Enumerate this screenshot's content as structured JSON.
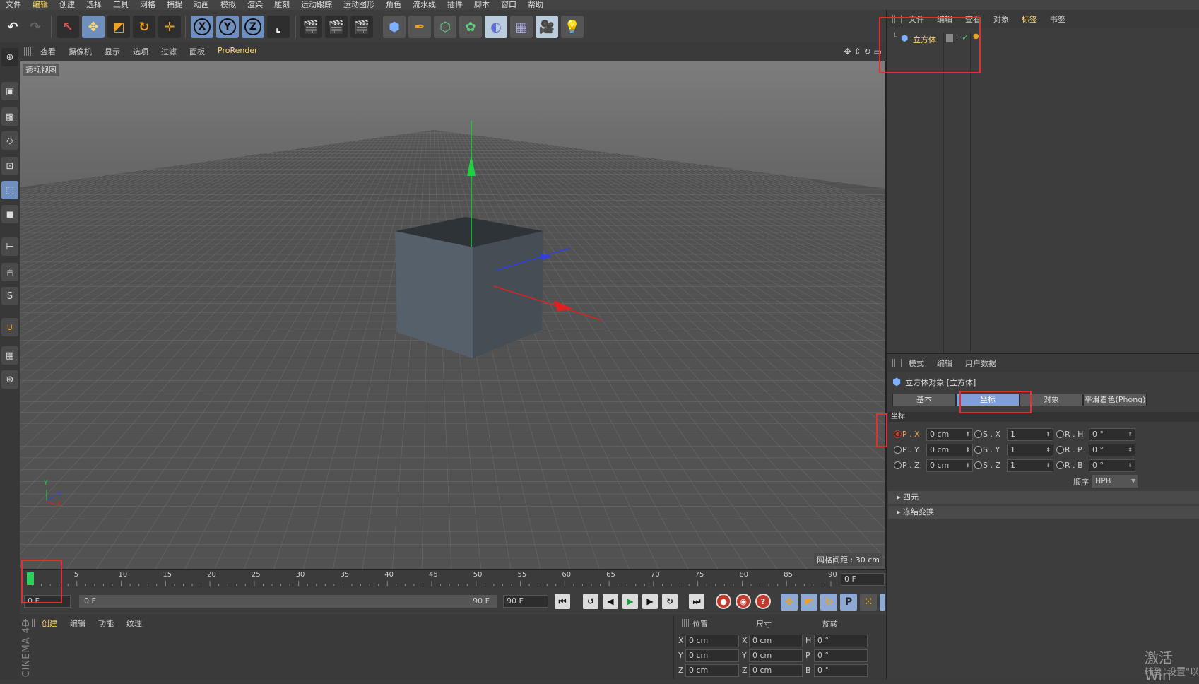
{
  "menubar": [
    "文件",
    "编辑",
    "创建",
    "选择",
    "工具",
    "网格",
    "捕捉",
    "动画",
    "模拟",
    "渲染",
    "雕刻",
    "运动跟踪",
    "运动图形",
    "角色",
    "流水线",
    "插件",
    "脚本",
    "窗口",
    "帮助"
  ],
  "toolbar": {
    "undo_icon": "undo-icon",
    "redo_icon": "redo-icon",
    "axis_x": "X",
    "axis_y": "Y",
    "axis_z": "Z"
  },
  "viewport": {
    "menu": [
      "查看",
      "摄像机",
      "显示",
      "选项",
      "过滤",
      "面板",
      "ProRender"
    ],
    "label": "透视视图",
    "grid_info": "网格间距 : 30 cm",
    "axis_y": "Y",
    "axis_x": "X",
    "axis_z": "Z"
  },
  "timeline": {
    "ticks": [
      "0",
      "5",
      "10",
      "15",
      "20",
      "25",
      "30",
      "35",
      "40",
      "45",
      "50",
      "55",
      "60",
      "65",
      "70",
      "75",
      "80",
      "85",
      "90"
    ],
    "current_frame": "0 F",
    "start_field": "0 F",
    "slider_start": "0 F",
    "slider_end": "90 F",
    "end_field": "90 F"
  },
  "material_panel": {
    "menu": [
      "创建",
      "编辑",
      "功能",
      "纹理"
    ],
    "vertical_text": "CINEMA 4D"
  },
  "coord_panel": {
    "headers": [
      "位置",
      "尺寸",
      "旋转"
    ],
    "rows": [
      {
        "pos_axis": "X",
        "pos": "0 cm",
        "size_axis": "X",
        "size": "0 cm",
        "rot_axis": "H",
        "rot": "0 °"
      },
      {
        "pos_axis": "Y",
        "pos": "0 cm",
        "size_axis": "Y",
        "size": "0 cm",
        "rot_axis": "P",
        "rot": "0 °"
      },
      {
        "pos_axis": "Z",
        "pos": "0 cm",
        "size_axis": "Z",
        "size": "0 cm",
        "rot_axis": "B",
        "rot": "0 °"
      }
    ]
  },
  "object_manager": {
    "menu": [
      "文件",
      "编辑",
      "查看",
      "对象",
      "标签",
      "书签"
    ],
    "object_name": "立方体"
  },
  "attribute_manager": {
    "menu": [
      "模式",
      "编辑",
      "用户数据"
    ],
    "title": "立方体对象 [立方体]",
    "tabs": [
      "基本",
      "坐标",
      "对象",
      "平滑着色(Phong)"
    ],
    "section": "坐标",
    "rows": [
      {
        "p_label": "P . X",
        "p_val": "0 cm",
        "s_label": "S . X",
        "s_val": "1",
        "r_label": "R . H",
        "r_val": "0 °"
      },
      {
        "p_label": "P . Y",
        "p_val": "0 cm",
        "s_label": "S . Y",
        "s_val": "1",
        "r_label": "R . P",
        "r_val": "0 °"
      },
      {
        "p_label": "P . Z",
        "p_val": "0 cm",
        "s_label": "S . Z",
        "s_val": "1",
        "r_label": "R . B",
        "r_val": "0 °"
      }
    ],
    "order_label": "顺序",
    "order_value": "HPB",
    "collapse1": "四元",
    "collapse2": "冻结变换"
  },
  "watermark": {
    "line1": "激活 Win",
    "line2": "转到\"设置\"以"
  },
  "colors": {
    "accent_blue": "#7f9fd6",
    "highlight_yellow": "#ffd66e",
    "annotation_red": "#e03030",
    "axis_x": "#e02020",
    "axis_y": "#20d040",
    "axis_z": "#3040e0"
  }
}
